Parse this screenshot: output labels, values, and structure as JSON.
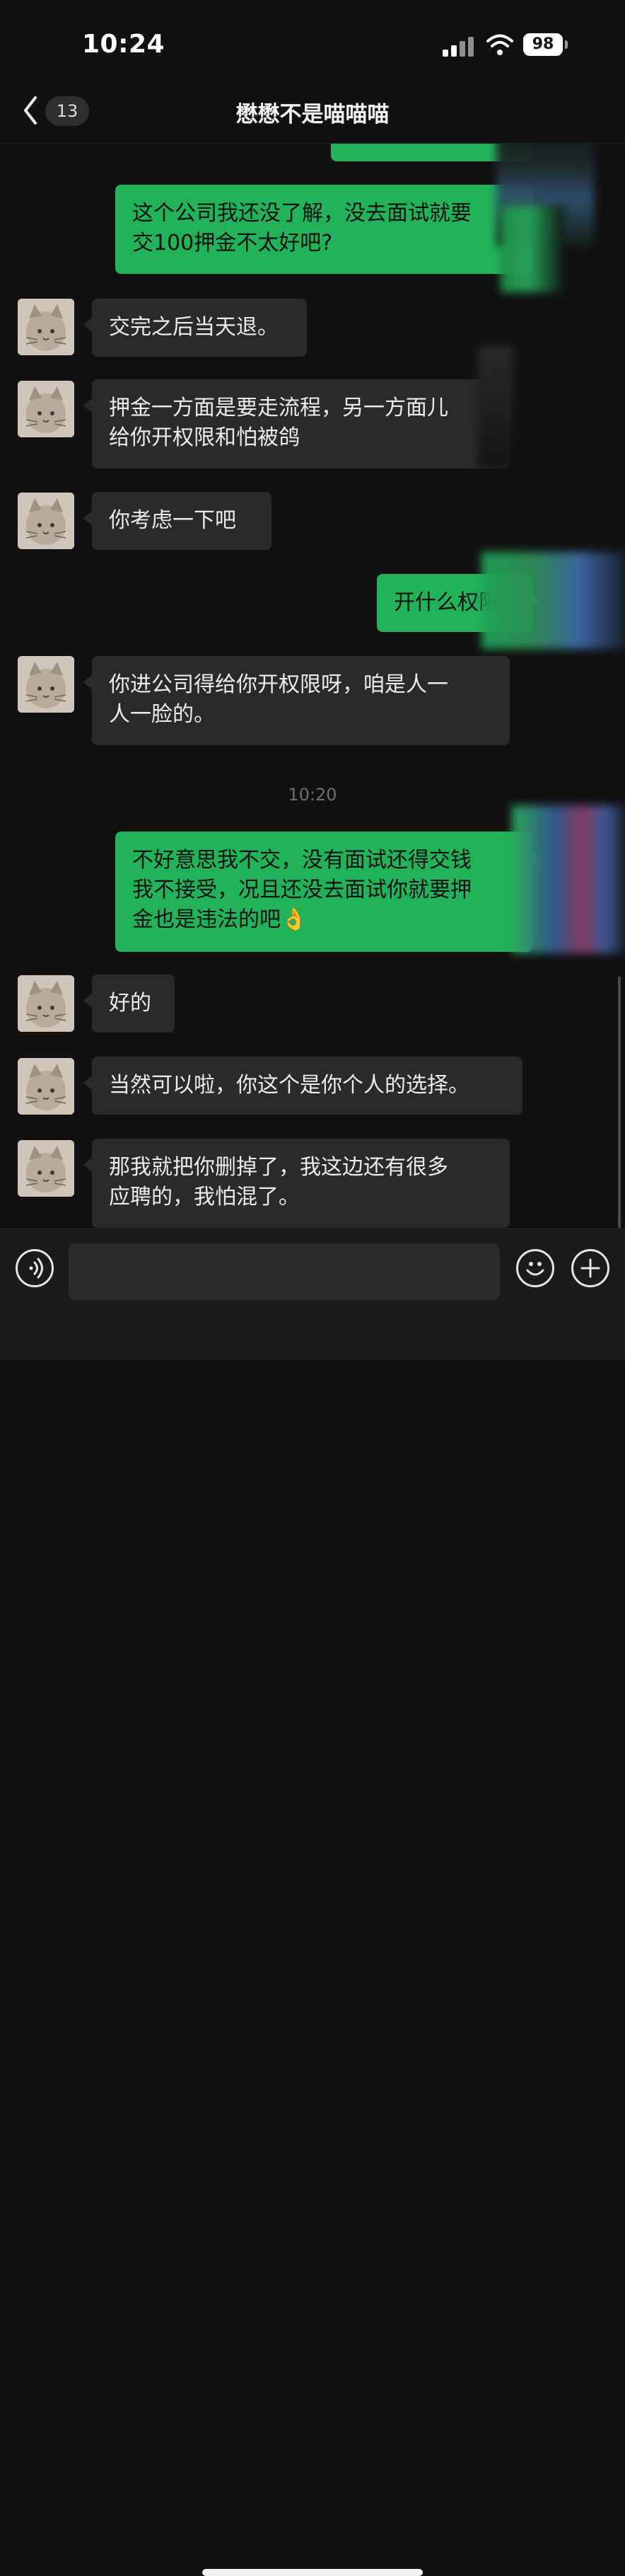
{
  "status": {
    "time": "10:24",
    "battery": "98"
  },
  "header": {
    "back_count": "13",
    "title": "懋懋不是喵喵喵"
  },
  "messages": [
    {
      "from": "me",
      "text": "这个公司我还没了解，没去面试就要\n交100押金不太好吧?"
    },
    {
      "from": "other",
      "text": "交完之后当天退。"
    },
    {
      "from": "other",
      "text": "押金一方面是要走流程，另一方面儿\n给你开权限和怕被鸽"
    },
    {
      "from": "other",
      "text": "你考虑一下吧"
    },
    {
      "from": "me",
      "text": "开什么权限"
    },
    {
      "from": "other",
      "text": "你进公司得给你开权限呀，咱是人一\n人一脸的。"
    },
    {
      "from": "time",
      "text": "10:20"
    },
    {
      "from": "me",
      "text": "不好意思我不交，没有面试还得交钱\n我不接受，况且还没去面试你就要押\n金也是违法的吧👌"
    },
    {
      "from": "other",
      "text": "好的"
    },
    {
      "from": "other",
      "text": "当然可以啦，你这个是你个人的选择。"
    },
    {
      "from": "other",
      "text": "那我就把你删掉了，我这边还有很多\n应聘的，我怕混了。"
    }
  ],
  "input": {
    "placeholder": ""
  },
  "colors": {
    "background": "#111111",
    "incoming_bubble": "#2a2a2a",
    "outgoing_bubble": "#22b25a"
  },
  "icons": {
    "back": "chevron-left-icon",
    "voice": "voice-icon",
    "emoji": "emoji-icon",
    "plus": "plus-icon"
  }
}
